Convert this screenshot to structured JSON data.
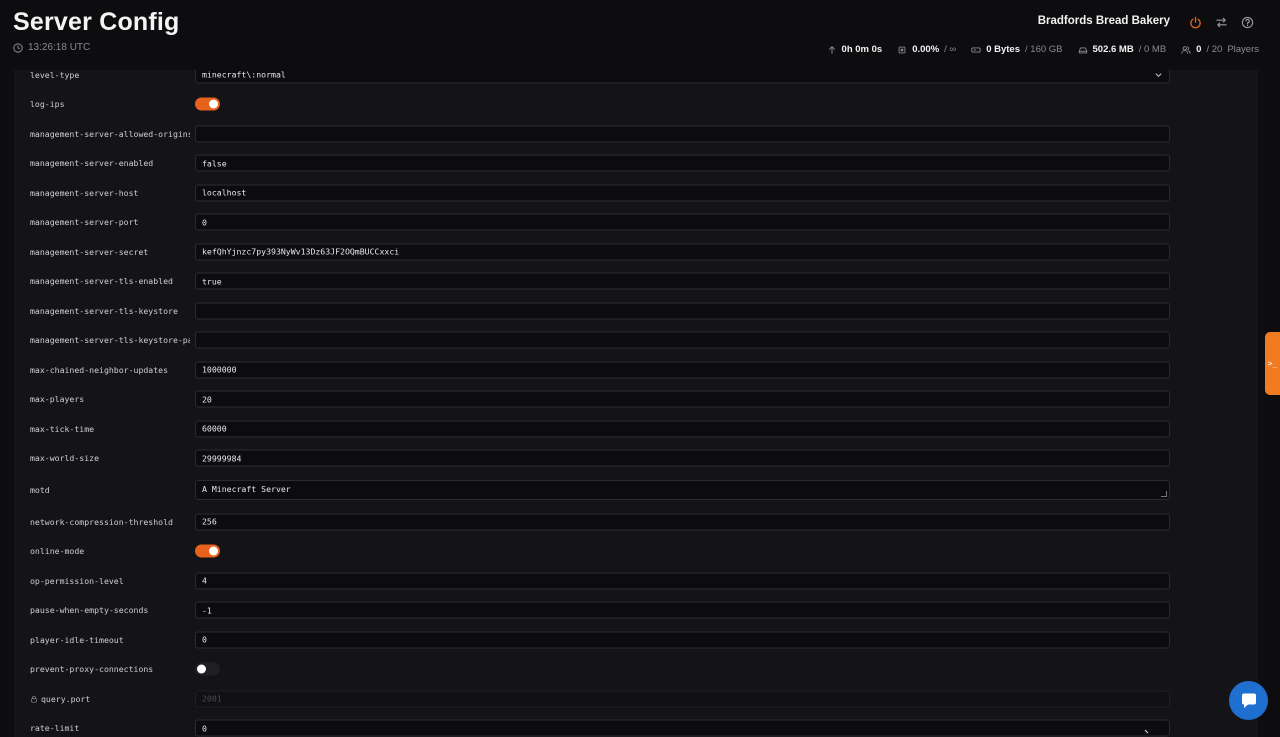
{
  "header": {
    "title": "Server Config",
    "time": "13:26:18 UTC",
    "server_name": "Bradfords Bread Bakery",
    "stats": {
      "uptime": "0h 0m 0s",
      "cpu_value": "0.00%",
      "cpu_limit": "/ ∞",
      "disk_value": "0 Bytes",
      "disk_limit": "/ 160 GB",
      "memory_value": "502.6 MB",
      "memory_limit": "/ 0 MB",
      "players_value": "0",
      "players_limit": "/ 20",
      "players_suffix": "Players"
    }
  },
  "rows": [
    {
      "label": "level-type",
      "value": "minecraft\\:normal"
    },
    {
      "label": "log-ips"
    },
    {
      "label": "management-server-allowed-origins",
      "value": ""
    },
    {
      "label": "management-server-enabled",
      "value": "false"
    },
    {
      "label": "management-server-host",
      "value": "localhost"
    },
    {
      "label": "management-server-port",
      "value": "0"
    },
    {
      "label": "management-server-secret",
      "value": "kefQhYjnzc7py393NyWv13Dz63JF2OQmBUCCxxci"
    },
    {
      "label": "management-server-tls-enabled",
      "value": "true"
    },
    {
      "label": "management-server-tls-keystore",
      "value": ""
    },
    {
      "label": "management-server-tls-keystore-password",
      "value": ""
    },
    {
      "label": "max-chained-neighbor-updates",
      "value": "1000000"
    },
    {
      "label": "max-players",
      "value": "20"
    },
    {
      "label": "max-tick-time",
      "value": "60000"
    },
    {
      "label": "max-world-size",
      "value": "29999984"
    },
    {
      "label": "motd",
      "value": "A Minecraft Server"
    },
    {
      "label": "network-compression-threshold",
      "value": "256"
    },
    {
      "label": "online-mode"
    },
    {
      "label": "op-permission-level",
      "value": "4"
    },
    {
      "label": "pause-when-empty-seconds",
      "value": "-1"
    },
    {
      "label": "player-idle-timeout",
      "value": "0"
    },
    {
      "label": "prevent-proxy-connections"
    },
    {
      "label": "query.port",
      "value": "2001"
    },
    {
      "label": "rate-limit",
      "value": "0"
    }
  ],
  "toggles": {
    "log_ips": true,
    "online_mode": true,
    "prevent_proxy_connections": false
  },
  "side_tab": ">_",
  "colors": {
    "accent": "#e8621d",
    "chat": "#1f6fd1",
    "background": "#0d0d10",
    "panel": "#141418"
  }
}
